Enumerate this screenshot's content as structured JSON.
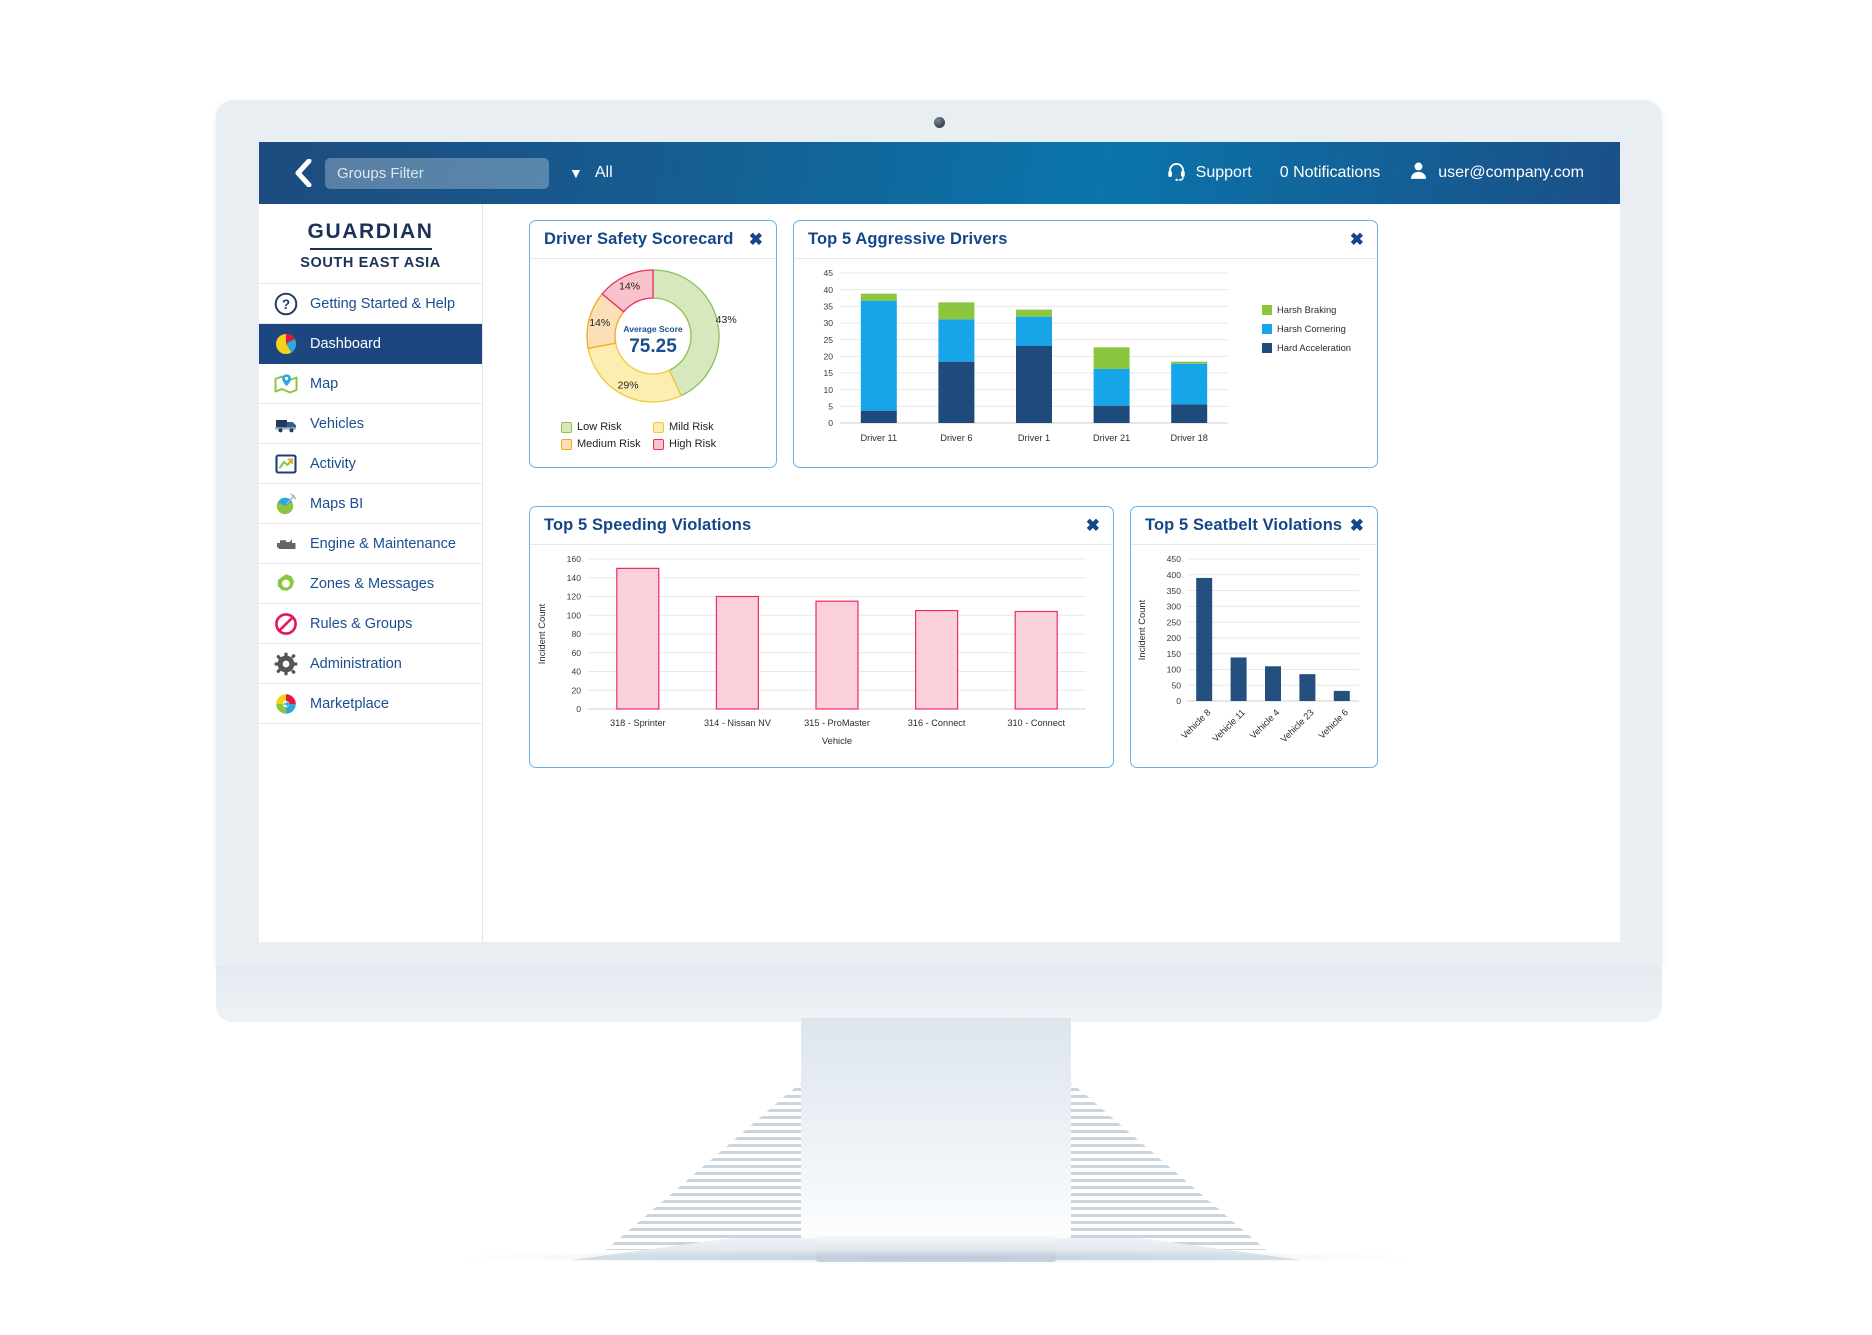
{
  "topbar": {
    "back_icon": "chevron-left-icon",
    "groups_filter_value": "",
    "groups_filter_placeholder": "Groups Filter",
    "caret": "▼",
    "all_label": "All",
    "support_label": "Support",
    "notifications_label": "0 Notifications",
    "user_email": "user@company.com",
    "accent_dark": "#1d4b7f",
    "accent_light": "#0a75ab"
  },
  "sidebar": {
    "logo_word": "GUARDIAN",
    "logo_region": "SOUTH EAST ASIA",
    "active_color": "#1d4681",
    "items": [
      {
        "label": "Getting Started & Help",
        "icon": "question-circle-icon",
        "active": false
      },
      {
        "label": "Dashboard",
        "icon": "pie-chart-icon",
        "active": true
      },
      {
        "label": "Map",
        "icon": "map-pin-icon",
        "active": false
      },
      {
        "label": "Vehicles",
        "icon": "truck-icon",
        "active": false
      },
      {
        "label": "Activity",
        "icon": "trend-line-icon",
        "active": false
      },
      {
        "label": "Maps BI",
        "icon": "globe-chart-icon",
        "active": false
      },
      {
        "label": "Engine & Maintenance",
        "icon": "engine-icon",
        "active": false
      },
      {
        "label": "Zones & Messages",
        "icon": "zone-gear-icon",
        "active": false
      },
      {
        "label": "Rules & Groups",
        "icon": "no-entry-icon",
        "active": false
      },
      {
        "label": "Administration",
        "icon": "gear-icon",
        "active": false
      },
      {
        "label": "Marketplace",
        "icon": "marketplace-icon",
        "active": false
      }
    ]
  },
  "panels": {
    "scorecard": {
      "title": "Driver Safety Scorecard",
      "close": "✖"
    },
    "aggressive": {
      "title": "Top 5 Aggressive Drivers",
      "close": "✖"
    },
    "speeding": {
      "title": "Top 5 Speeding Violations",
      "close": "✖"
    },
    "seatbelt": {
      "title": "Top 5 Seatbelt Violations",
      "close": "✖"
    }
  },
  "chart_data": [
    {
      "id": "scorecard",
      "type": "pie",
      "title": "Driver Safety Scorecard",
      "center_label": "Average Score",
      "center_value": "75.25",
      "legend_position": "bottom",
      "labels": [
        "Low Risk",
        "Mild Risk",
        "Medium Risk",
        "High Risk"
      ],
      "values": [
        43,
        29,
        14,
        14
      ],
      "value_labels": [
        "43%",
        "29%",
        "14%",
        "14%"
      ],
      "colors": [
        "#d7e8bf",
        "#fbeeb0",
        "#fbdfb6",
        "#f9c3cd"
      ],
      "stroke_colors": [
        "#8cc152",
        "#f3c736",
        "#f5a623",
        "#ec2d5e"
      ]
    },
    {
      "id": "aggressive",
      "type": "bar",
      "stacked": true,
      "title": "Top 5 Aggressive Drivers",
      "xlabel": "",
      "ylabel": "",
      "ylim": [
        0,
        45
      ],
      "yticks": [
        0,
        5,
        10,
        15,
        20,
        25,
        30,
        35,
        40,
        45
      ],
      "grid": true,
      "legend_position": "right",
      "categories": [
        "Driver 11",
        "Driver 6",
        "Driver 1",
        "Driver 21",
        "Driver 18"
      ],
      "series": [
        {
          "name": "Hard Acceleration",
          "color": "#1f4a7c",
          "values": [
            3.7,
            18.4,
            23.1,
            5.2,
            5.6
          ]
        },
        {
          "name": "Harsh Cornering",
          "color": "#16a5e8",
          "values": [
            33.0,
            12.7,
            8.8,
            11.0,
            12.2
          ]
        },
        {
          "name": "Harsh Braking",
          "color": "#8cc63e",
          "values": [
            2.1,
            5.1,
            2.1,
            6.5,
            0.6
          ]
        }
      ],
      "legend_order": [
        "Harsh Braking",
        "Harsh Cornering",
        "Hard Acceleration"
      ]
    },
    {
      "id": "speeding",
      "type": "bar",
      "title": "Top 5 Speeding Violations",
      "xlabel": "Vehicle",
      "ylabel": "Incident Count",
      "ylim": [
        0,
        160
      ],
      "yticks": [
        0,
        20,
        40,
        60,
        80,
        100,
        120,
        140,
        160
      ],
      "grid": true,
      "categories": [
        "318 - Sprinter",
        "314 - Nissan NV",
        "315 - ProMaster",
        "316 - Connect",
        "310 - Connect"
      ],
      "values": [
        150,
        120,
        115,
        105,
        104
      ],
      "bar_fill": "#fad1da",
      "bar_stroke": "#ec2d5e"
    },
    {
      "id": "seatbelt",
      "type": "bar",
      "title": "Top 5 Seatbelt Violations",
      "xlabel": "",
      "ylabel": "Incident Count",
      "ylim": [
        0,
        450
      ],
      "yticks": [
        0,
        50,
        100,
        150,
        200,
        250,
        300,
        350,
        400,
        450
      ],
      "grid": true,
      "categories": [
        "Vehicle 8",
        "Vehicle 11",
        "Vehicle 4",
        "Vehicle 23",
        "Vehicle 6"
      ],
      "values": [
        390,
        138,
        110,
        85,
        32
      ],
      "bar_fill": "#24507f",
      "bar_stroke": "#24507f"
    }
  ]
}
